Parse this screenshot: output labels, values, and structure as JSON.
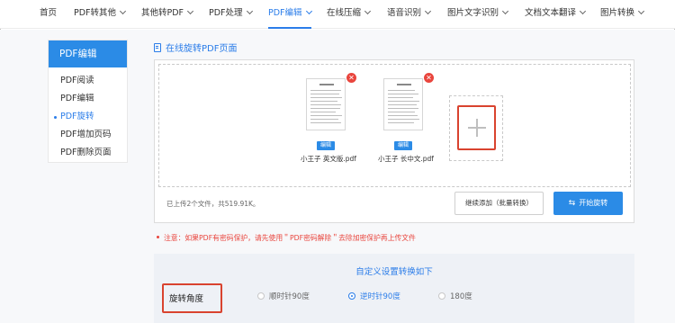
{
  "nav": {
    "items": [
      {
        "label": "首页",
        "has_menu": false
      },
      {
        "label": "PDF转其他",
        "has_menu": true
      },
      {
        "label": "其他转PDF",
        "has_menu": true
      },
      {
        "label": "PDF处理",
        "has_menu": true
      },
      {
        "label": "PDF编辑",
        "has_menu": true,
        "active": true
      },
      {
        "label": "在线压缩",
        "has_menu": true
      },
      {
        "label": "语音识别",
        "has_menu": true
      },
      {
        "label": "图片文字识别",
        "has_menu": true
      },
      {
        "label": "文档文本翻译",
        "has_menu": true
      },
      {
        "label": "图片转换",
        "has_menu": true
      }
    ]
  },
  "sidebar": {
    "title": "PDF编辑",
    "items": [
      {
        "label": "PDF阅读",
        "active": false
      },
      {
        "label": "PDF编辑",
        "active": false
      },
      {
        "label": "PDF旋转",
        "active": true
      },
      {
        "label": "PDF增加页码",
        "active": false
      },
      {
        "label": "PDF删除页面",
        "active": false
      }
    ]
  },
  "main": {
    "title": "在线旋转PDF页面",
    "files": [
      {
        "name": "小王子 英文版.pdf",
        "edit_label": "编辑",
        "remove_icon": "close-circle-icon"
      },
      {
        "name": "小王子 长中文.pdf",
        "edit_label": "编辑",
        "remove_icon": "close-circle-icon"
      }
    ],
    "add_icon": "plus-icon",
    "upload_info": "已上传2个文件，共519.91K。",
    "continue_label": "继续添加（批量转换）",
    "start_label": "开始旋转",
    "start_icon": "swap-arrows-icon"
  },
  "notice": {
    "text": "注意：如果PDF有密码保护，请先使用＂PDF密码解除＂去除加密保护再上传文件"
  },
  "settings": {
    "title": "自定义设置转换如下",
    "angle_label": "旋转角度",
    "options": [
      {
        "label": "顺时针90度",
        "checked": false
      },
      {
        "label": "逆时针90度",
        "checked": true
      },
      {
        "label": "180度",
        "checked": false
      }
    ]
  },
  "colors": {
    "accent": "#2b8be6",
    "danger": "#e9453d",
    "highlight": "#d9432f"
  }
}
